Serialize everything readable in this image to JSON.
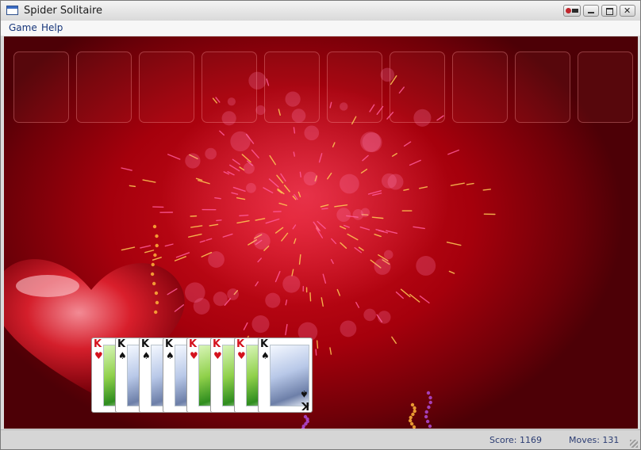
{
  "window": {
    "title": "Spider Solitaire",
    "icons": [
      "app-icon",
      "extra-icon",
      "minimize-icon",
      "maximize-icon",
      "close-icon"
    ]
  },
  "menu": {
    "items": [
      {
        "label": "Game"
      },
      {
        "label": "Help"
      }
    ]
  },
  "table": {
    "empty_slots": 10,
    "colors": {
      "felt": "#b3000d",
      "spark_pink": "#ff5a9a",
      "spark_gold": "#ffcc55"
    }
  },
  "completed_stacks": [
    {
      "rank": "K",
      "suit": "heart",
      "symbol": "♥"
    },
    {
      "rank": "K",
      "suit": "spade",
      "symbol": "♠"
    },
    {
      "rank": "K",
      "suit": "spade",
      "symbol": "♠"
    },
    {
      "rank": "K",
      "suit": "spade",
      "symbol": "♠"
    },
    {
      "rank": "K",
      "suit": "heart",
      "symbol": "♥"
    },
    {
      "rank": "K",
      "suit": "heart",
      "symbol": "♥"
    },
    {
      "rank": "K",
      "suit": "heart",
      "symbol": "♥"
    },
    {
      "rank": "K",
      "suit": "spade",
      "symbol": "♠"
    }
  ],
  "status": {
    "score": "Score: 1169",
    "moves": "Moves:  131"
  }
}
